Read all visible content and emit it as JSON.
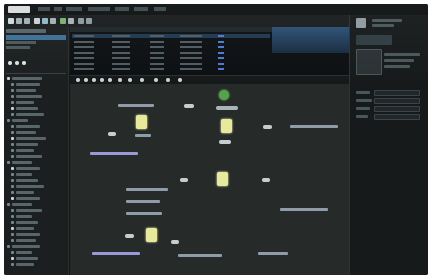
{
  "colors": {
    "canvas": "#262b29",
    "node": "#e6ea9a",
    "node_start": "#52a34a",
    "selection": "#3d6f95",
    "panel": "#1c1f20"
  },
  "icons": [
    "app-logo-icon",
    "new-icon",
    "open-icon",
    "save-icon",
    "cursor-icon",
    "link-icon",
    "zoom-icon",
    "run-icon",
    "stop-icon",
    "grid-icon",
    "settings-icon"
  ],
  "menubar": {
    "items": [
      "",
      "",
      "",
      "",
      "",
      "",
      ""
    ]
  },
  "left_panel": {
    "tree_rows": 32
  },
  "list_panel": {
    "rows": 7
  },
  "canvas": {
    "nodes": 6
  }
}
